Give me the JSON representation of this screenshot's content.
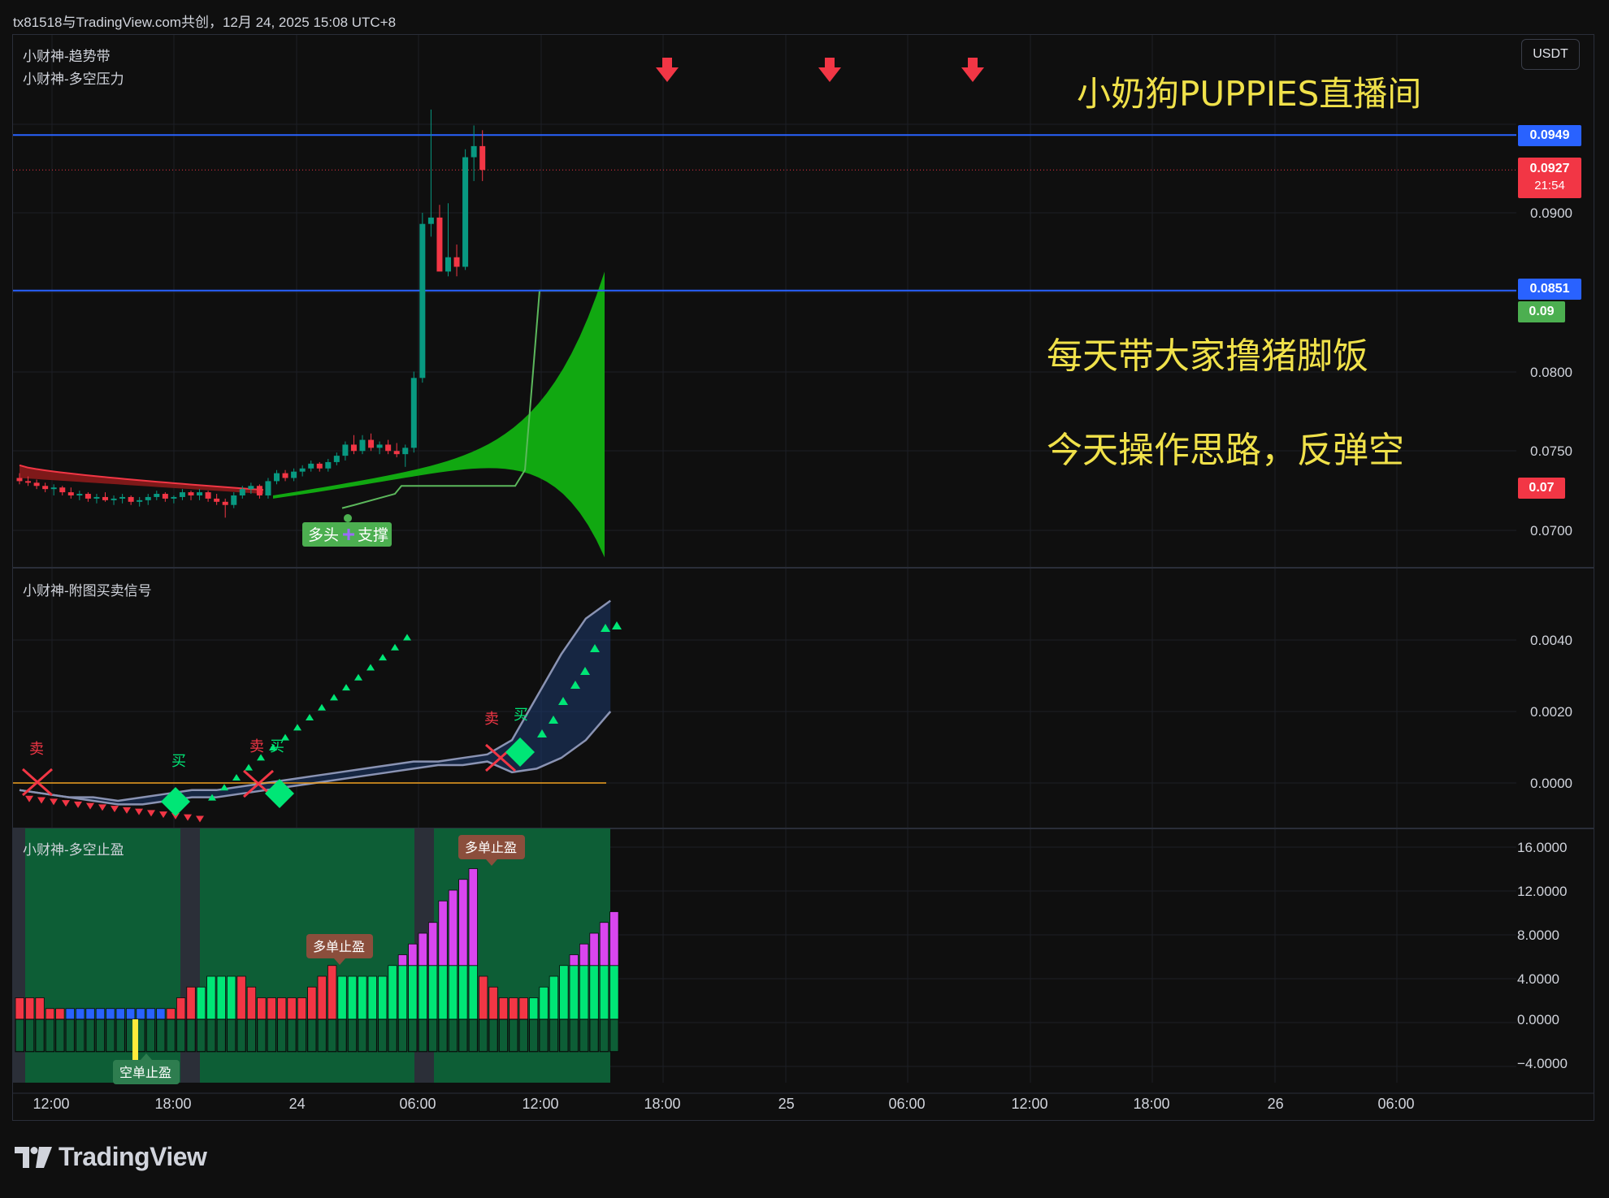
{
  "header": {
    "text": "tx81518与TradingView.com共创，12月 24, 2025 15:08 UTC+8"
  },
  "currency": "USDT",
  "main_panel": {
    "indicators": [
      "小财神-趋势带",
      "小财神-多空压力"
    ],
    "price_axis": [
      "0.0900",
      "0.0800",
      "0.0750",
      "0.0700"
    ],
    "price_tags": [
      {
        "label": "0.0949",
        "color": "#2962ff"
      },
      {
        "label": "0.0927",
        "sub": "21:54",
        "color": "#f23645"
      },
      {
        "label": "0.0851",
        "color": "#2962ff"
      },
      {
        "label": "0.09",
        "color": "#4caf50"
      },
      {
        "label": "0.07",
        "color": "#f23645"
      }
    ],
    "support_label": "多头",
    "support_label2": "支撑",
    "overlay": {
      "title": "小奶狗PUPPIES直播间",
      "line1": "每天带大家撸猪脚饭",
      "line2": "今天操作思路，反弹空"
    }
  },
  "signal_panel": {
    "title": "小财神-附图买卖信号",
    "axis": [
      "0.0040",
      "0.0020",
      "0.0000"
    ],
    "signals": [
      "卖",
      "买",
      "卖",
      "买",
      "卖",
      "买"
    ]
  },
  "stop_panel": {
    "title": "小财神-多空止盈",
    "axis": [
      "16.0000",
      "12.0000",
      "8.0000",
      "4.0000",
      "0.0000",
      "−4.0000"
    ],
    "callouts": [
      "多单止盈",
      "多单止盈",
      "空单止盈"
    ]
  },
  "time_axis": [
    "12:00",
    "18:00",
    "24",
    "06:00",
    "12:00",
    "18:00",
    "25",
    "06:00",
    "12:00",
    "18:00",
    "26",
    "06:00"
  ],
  "footer": {
    "brand": "TradingView"
  },
  "colors": {
    "up": "#089981",
    "down": "#f23645",
    "blue_line": "#2962ff",
    "overlay_text": "#f0e14a",
    "band_green": "#11a811",
    "magenta": "#d946ef"
  },
  "chart_data": [
    {
      "type": "candlestick",
      "title": "",
      "x_range": [
        "12月24日 10:00",
        "12月26日 10:00"
      ],
      "ylim": [
        0.068,
        0.098
      ],
      "hlines": [
        0.0949,
        0.0851
      ],
      "last_price": 0.0927,
      "candles": [
        [
          0.0733,
          0.0736,
          0.0729,
          0.0731
        ],
        [
          0.0731,
          0.0734,
          0.0728,
          0.073
        ],
        [
          0.073,
          0.0732,
          0.0726,
          0.0728
        ],
        [
          0.0728,
          0.073,
          0.0724,
          0.0726
        ],
        [
          0.0726,
          0.0729,
          0.0722,
          0.0727
        ],
        [
          0.0727,
          0.0728,
          0.0722,
          0.0724
        ],
        [
          0.0724,
          0.0727,
          0.072,
          0.0722
        ],
        [
          0.0722,
          0.0725,
          0.0719,
          0.0723
        ],
        [
          0.0723,
          0.0724,
          0.0718,
          0.072
        ],
        [
          0.072,
          0.0723,
          0.0717,
          0.0721
        ],
        [
          0.0721,
          0.0724,
          0.0718,
          0.0719
        ],
        [
          0.0719,
          0.0722,
          0.0716,
          0.072
        ],
        [
          0.072,
          0.0723,
          0.0717,
          0.0721
        ],
        [
          0.0721,
          0.0722,
          0.0716,
          0.0718
        ],
        [
          0.0718,
          0.0721,
          0.0715,
          0.0719
        ],
        [
          0.0719,
          0.0723,
          0.0716,
          0.0721
        ],
        [
          0.0721,
          0.0725,
          0.0719,
          0.0723
        ],
        [
          0.0723,
          0.0724,
          0.0718,
          0.072
        ],
        [
          0.072,
          0.0722,
          0.0717,
          0.0721
        ],
        [
          0.0721,
          0.0726,
          0.0719,
          0.0724
        ],
        [
          0.0724,
          0.0725,
          0.0719,
          0.0722
        ],
        [
          0.0722,
          0.0726,
          0.0719,
          0.0724
        ],
        [
          0.0724,
          0.0725,
          0.0718,
          0.072
        ],
        [
          0.072,
          0.0723,
          0.0716,
          0.0718
        ],
        [
          0.0718,
          0.072,
          0.0708,
          0.0716
        ],
        [
          0.0716,
          0.0724,
          0.0714,
          0.0722
        ],
        [
          0.0722,
          0.0728,
          0.072,
          0.0726
        ],
        [
          0.0726,
          0.073,
          0.0723,
          0.0728
        ],
        [
          0.0728,
          0.0729,
          0.072,
          0.0722
        ],
        [
          0.0722,
          0.0733,
          0.072,
          0.0731
        ],
        [
          0.0731,
          0.0738,
          0.0729,
          0.0736
        ],
        [
          0.0736,
          0.0738,
          0.0731,
          0.0733
        ],
        [
          0.0733,
          0.0739,
          0.0731,
          0.0737
        ],
        [
          0.0737,
          0.0741,
          0.0734,
          0.0739
        ],
        [
          0.0739,
          0.0744,
          0.0737,
          0.0742
        ],
        [
          0.0742,
          0.0743,
          0.0737,
          0.0739
        ],
        [
          0.0739,
          0.0745,
          0.0737,
          0.0743
        ],
        [
          0.0743,
          0.0749,
          0.0741,
          0.0747
        ],
        [
          0.0747,
          0.0756,
          0.0744,
          0.0754
        ],
        [
          0.0754,
          0.076,
          0.0748,
          0.075
        ],
        [
          0.075,
          0.076,
          0.0748,
          0.0757
        ],
        [
          0.0757,
          0.0761,
          0.075,
          0.0752
        ],
        [
          0.0752,
          0.0756,
          0.0748,
          0.0754
        ],
        [
          0.0754,
          0.0757,
          0.0748,
          0.075
        ],
        [
          0.075,
          0.0755,
          0.0746,
          0.0748
        ],
        [
          0.0748,
          0.0754,
          0.074,
          0.0752
        ],
        [
          0.0752,
          0.08,
          0.0749,
          0.0796
        ],
        [
          0.0796,
          0.09,
          0.0793,
          0.0893
        ],
        [
          0.0893,
          0.0965,
          0.0885,
          0.0897
        ],
        [
          0.0897,
          0.0905,
          0.0872,
          0.0863
        ],
        [
          0.0863,
          0.0906,
          0.086,
          0.0872
        ],
        [
          0.0872,
          0.088,
          0.086,
          0.0866
        ],
        [
          0.0866,
          0.094,
          0.0864,
          0.0935
        ],
        [
          0.0935,
          0.0955,
          0.092,
          0.0942
        ],
        [
          0.0942,
          0.0952,
          0.092,
          0.0927
        ]
      ]
    },
    {
      "type": "line",
      "title": "",
      "ylim": [
        -0.001,
        0.0055
      ],
      "series": [
        {
          "values": [
            -0.0002,
            -0.0003,
            -0.0004,
            -0.0004,
            -0.0005,
            -0.0004,
            -0.0003,
            -0.0002,
            -0.0002,
            -0.0001,
            0.0,
            0.0001,
            0.0002,
            0.0003,
            0.0004,
            0.0005,
            0.0006,
            0.0006,
            0.0007,
            0.0008,
            0.0012,
            0.0024,
            0.0036,
            0.0046,
            0.0051
          ]
        },
        {
          "values": [
            -0.0002,
            -0.0003,
            -0.0004,
            -0.0005,
            -0.0006,
            -0.0006,
            -0.0005,
            -0.0004,
            -0.0004,
            -0.0003,
            -0.0002,
            -0.0001,
            0.0,
            0.0001,
            0.0002,
            0.0003,
            0.0004,
            0.0005,
            0.0005,
            0.0006,
            0.0003,
            0.0004,
            0.0007,
            0.0012,
            0.002
          ]
        }
      ]
    },
    {
      "type": "bar",
      "title": "",
      "ylim": [
        -5,
        17
      ],
      "values": [
        2,
        2,
        2,
        1,
        1,
        1,
        1,
        1,
        1,
        1,
        1,
        1,
        1,
        1,
        1,
        1,
        2,
        3,
        3,
        4,
        4,
        4,
        4,
        3,
        2,
        2,
        2,
        2,
        2,
        3,
        4,
        5,
        4,
        4,
        4,
        4,
        4,
        5,
        6,
        7,
        8,
        9,
        11,
        12,
        13,
        14,
        4,
        3,
        2,
        2,
        2,
        2,
        3,
        4,
        5,
        6,
        7,
        8,
        9,
        10
      ],
      "negative_values": [
        -3,
        -3,
        -3,
        -3,
        -3,
        -3,
        -3,
        -3,
        -3,
        -3,
        -3,
        -3,
        -3,
        -3,
        -3,
        -3,
        -3,
        -3,
        -3,
        -3,
        -3,
        -3,
        -3,
        -3,
        -3,
        -3,
        -3,
        -3,
        -3,
        -3,
        -3,
        -3,
        -3,
        -3,
        -3,
        -3,
        -3,
        -3,
        -3,
        -3,
        -3,
        -3,
        -3,
        -3,
        -3,
        -3,
        -3,
        -3,
        -3,
        -3,
        -3,
        -3,
        -3,
        -3,
        -3,
        -3,
        -3,
        -3,
        -3,
        -3
      ]
    }
  ]
}
